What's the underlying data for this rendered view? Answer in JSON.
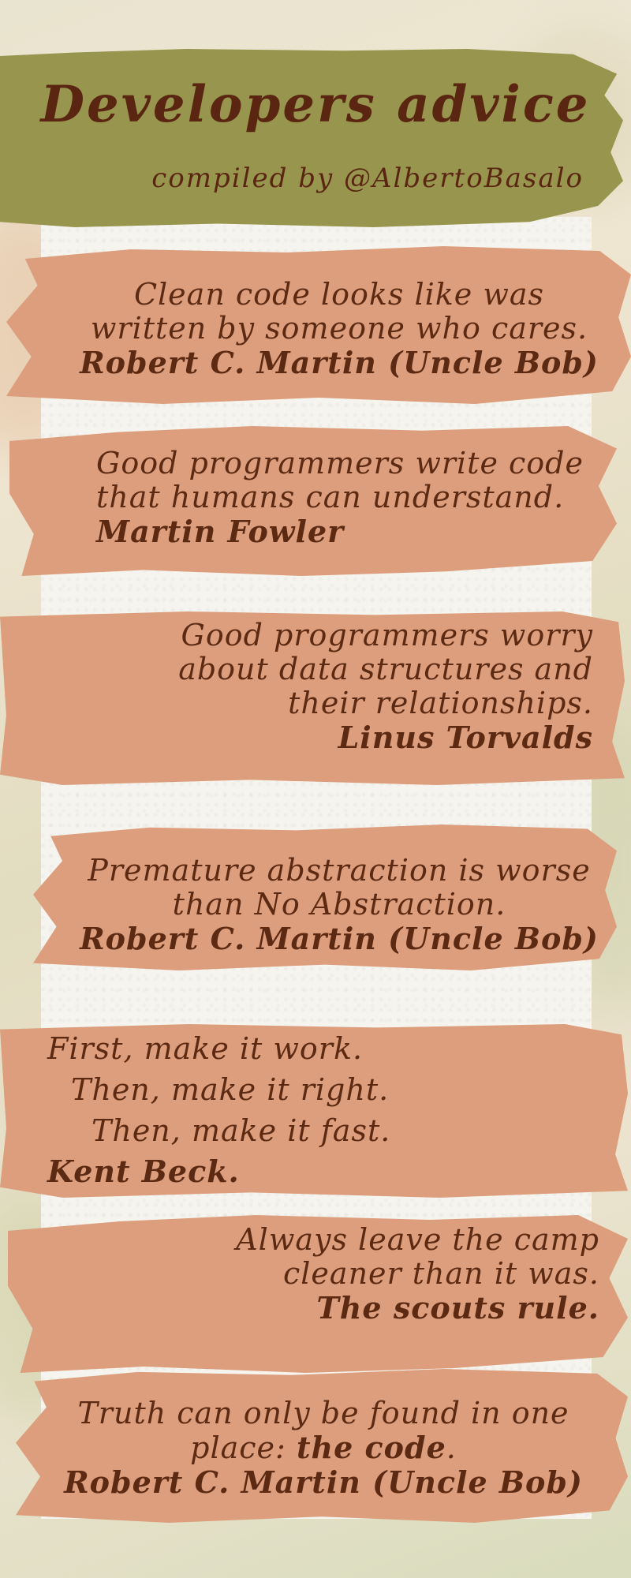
{
  "header": {
    "title": "Developers advice",
    "subtitle": "compiled by @AlbertoBasalo"
  },
  "quotes": [
    {
      "lines": [
        "Clean code looks like was",
        "written by someone who cares."
      ],
      "author": "Robert C. Martin (Uncle Bob)"
    },
    {
      "lines": [
        "Good programmers write code",
        "that humans can understand."
      ],
      "author": "Martin Fowler"
    },
    {
      "lines": [
        "Good programmers worry",
        "about data structures and",
        "their relationships."
      ],
      "author": "Linus Torvalds"
    },
    {
      "lines": [
        "Premature abstraction is worse",
        "than No Abstraction."
      ],
      "author": "Robert C. Martin (Uncle Bob)"
    },
    {
      "lines": [
        "First, make it work.",
        "Then, make it right.",
        "Then, make it fast."
      ],
      "author": "Kent Beck."
    },
    {
      "lines": [
        "Always leave the camp",
        "cleaner than it was."
      ],
      "author": "The scouts rule."
    },
    {
      "lines": [
        "Truth can only be found in one"
      ],
      "line2_prefix": "place: ",
      "line2_bold": "the code",
      "line2_suffix": ".",
      "author": "Robert C. Martin (Uncle Bob)"
    }
  ],
  "colors": {
    "header_band": "#98954e",
    "brush_stroke": "#dc9e7c",
    "text": "#5c2a12",
    "paper": "#f6f4ef"
  }
}
